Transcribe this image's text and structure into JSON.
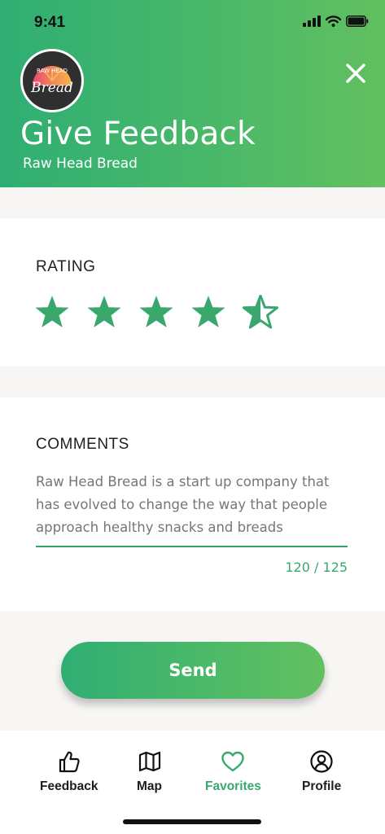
{
  "status_bar": {
    "time": "9:41",
    "icons": [
      "cellular-signal-icon",
      "wifi-icon",
      "battery-icon"
    ]
  },
  "header": {
    "logo": {
      "text_top": "RAW HEAD",
      "text_main": "Bread"
    },
    "title": "Give Feedback",
    "subtitle": "Raw Head Bread",
    "close_icon": "close-icon"
  },
  "rating": {
    "label": "RATING",
    "value": 4.5,
    "max": 5
  },
  "comments": {
    "label": "COMMENTS",
    "text": "Raw Head Bread is a start up company that has evolved to change the way that people approach healthy snacks and breads",
    "counter": "120 / 125"
  },
  "send_button": {
    "label": "Send"
  },
  "tab_bar": {
    "tabs": [
      {
        "label": "Feedback",
        "icon": "thumbs-up-icon",
        "active": false
      },
      {
        "label": "Map",
        "icon": "map-icon",
        "active": false
      },
      {
        "label": "Favorites",
        "icon": "heart-icon",
        "active": true
      },
      {
        "label": "Profile",
        "icon": "profile-icon",
        "active": false
      }
    ]
  },
  "colors": {
    "accent": "#3aa86e",
    "gradient_start": "#2fae73",
    "gradient_end": "#62c05f",
    "background": "#f7f6f4"
  }
}
